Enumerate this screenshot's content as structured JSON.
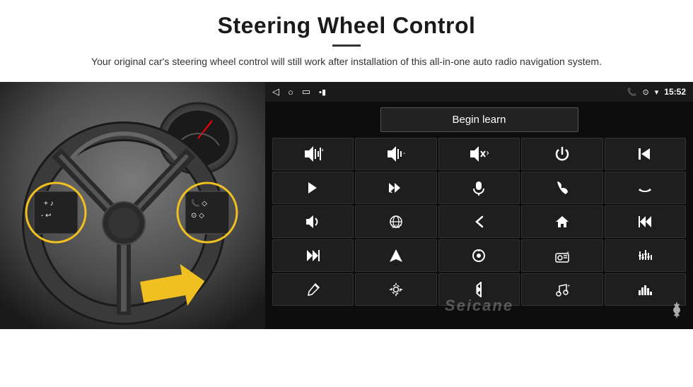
{
  "header": {
    "title": "Steering Wheel Control",
    "subtitle": "Your original car's steering wheel control will still work after installation of this all-in-one auto radio navigation system."
  },
  "android_panel": {
    "status_bar": {
      "time": "15:52",
      "back_icon": "◁",
      "home_icon": "□",
      "recent_icon": "▭",
      "signal_icon": "▪▪",
      "phone_icon": "📞",
      "location_icon": "⊙",
      "wifi_icon": "▾"
    },
    "begin_learn_label": "Begin learn",
    "watermark": "Seicane",
    "controls": [
      {
        "icon": "🔊+",
        "label": "vol-up"
      },
      {
        "icon": "🔊-",
        "label": "vol-down"
      },
      {
        "icon": "🔇",
        "label": "mute"
      },
      {
        "icon": "⏻",
        "label": "power"
      },
      {
        "icon": "⏮",
        "label": "prev-track"
      },
      {
        "icon": "⏭",
        "label": "next-track"
      },
      {
        "icon": "✂⏭",
        "label": "fast-forward"
      },
      {
        "icon": "🎤",
        "label": "mic"
      },
      {
        "icon": "📞",
        "label": "call"
      },
      {
        "icon": "📞↩",
        "label": "hang-up"
      },
      {
        "icon": "📢",
        "label": "speaker"
      },
      {
        "icon": "360°",
        "label": "360-view"
      },
      {
        "icon": "↩",
        "label": "back"
      },
      {
        "icon": "🏠",
        "label": "home"
      },
      {
        "icon": "⏮⏮",
        "label": "rewind"
      },
      {
        "icon": "⏭⏭",
        "label": "skip-forward"
      },
      {
        "icon": "▶",
        "label": "navigate"
      },
      {
        "icon": "⏺",
        "label": "source"
      },
      {
        "icon": "📻",
        "label": "radio"
      },
      {
        "icon": "⚙",
        "label": "equalizer"
      },
      {
        "icon": "✏",
        "label": "edit"
      },
      {
        "icon": "⚙",
        "label": "settings2"
      },
      {
        "icon": "✱",
        "label": "bluetooth"
      },
      {
        "icon": "♪",
        "label": "music"
      },
      {
        "icon": "📊",
        "label": "spectrum"
      }
    ]
  }
}
